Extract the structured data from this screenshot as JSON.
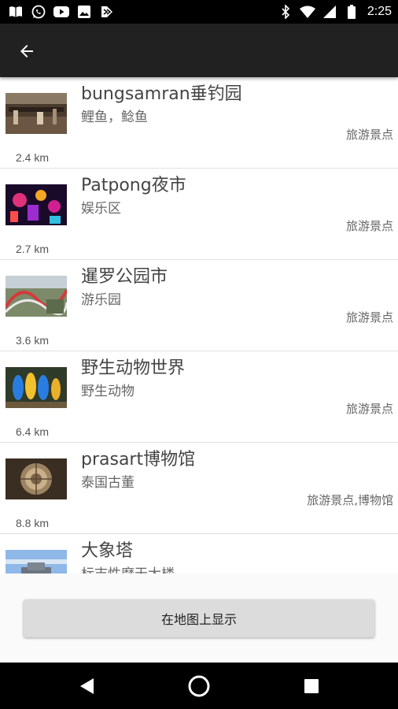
{
  "status_bar": {
    "time": "2:25",
    "left_icons": [
      "notification-book-icon",
      "whatsapp-icon",
      "youtube-icon",
      "photos-icon",
      "flag-icon"
    ],
    "right_icons": [
      "bluetooth-icon",
      "wifi-icon",
      "signal-icon",
      "battery-icon"
    ]
  },
  "app_bar": {
    "back_icon": "arrow-back-icon"
  },
  "places": [
    {
      "title": "bungsamran垂钓园",
      "subtitle": "鲤鱼，鲶鱼",
      "category": "旅游景点",
      "distance": "2.4 km"
    },
    {
      "title": "Patpong夜市",
      "subtitle": "娱乐区",
      "category": "旅游景点",
      "distance": "2.7 km"
    },
    {
      "title": "暹罗公园市",
      "subtitle": "游乐园",
      "category": "旅游景点",
      "distance": "3.6 km"
    },
    {
      "title": "野生动物世界",
      "subtitle": "野生动物",
      "category": "旅游景点",
      "distance": "6.4 km"
    },
    {
      "title": "prasart博物馆",
      "subtitle": "泰国古董",
      "category": "旅游景点,博物馆",
      "distance": "8.8 km"
    },
    {
      "title": "大象塔",
      "subtitle": "标志性摩天大楼",
      "category": "",
      "distance": ""
    }
  ],
  "footer": {
    "map_button_label": "在地图上显示"
  },
  "nav_bar": {
    "icons": [
      "back-triangle-icon",
      "home-circle-icon",
      "recents-square-icon"
    ]
  },
  "colors": {
    "app_bar": "#212121",
    "status_bar": "#000000",
    "button": "#dcdcdc"
  }
}
